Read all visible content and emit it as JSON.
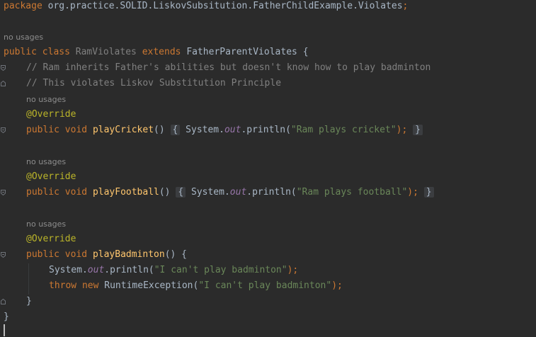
{
  "editor": {
    "package_line": {
      "keyword": "package",
      "name": "org.practice.SOLID.LiskovSubsitution.FatherChildExample.Violates",
      "semicolon": ";"
    },
    "hint_class": "no usages",
    "class_decl": {
      "kw_public": "public",
      "kw_class": "class",
      "name": "RamViolates",
      "kw_extends": "extends",
      "parent": "FatherParentViolates",
      "brace": "{"
    },
    "comment1": "// Ram inherits Father's abilities but doesn't know how to play badminton",
    "comment2": "// This violates Liskov Substitution Principle",
    "methods": [
      {
        "hint": "no usages",
        "annotation": "@Override",
        "kw_public": "public",
        "kw_void": "void",
        "name": "playCricket",
        "parens": "()",
        "open": "{",
        "sys": "System.",
        "out": "out",
        "println": ".println(",
        "string": "\"Ram plays cricket\"",
        "close_call": ");",
        "close": "}"
      },
      {
        "hint": "no usages",
        "annotation": "@Override",
        "kw_public": "public",
        "kw_void": "void",
        "name": "playFootball",
        "parens": "()",
        "open": "{",
        "sys": "System.",
        "out": "out",
        "println": ".println(",
        "string": "\"Ram plays football\"",
        "close_call": ");",
        "close": "}"
      },
      {
        "hint": "no usages",
        "annotation": "@Override",
        "kw_public": "public",
        "kw_void": "void",
        "name": "playBadminton",
        "parens": "()",
        "open": "{",
        "sys": "System.",
        "out": "out",
        "println": ".println(",
        "string": "\"I can't play badminton\"",
        "close_call": ");",
        "throw_kw": "throw",
        "new_kw": "new",
        "exception": "RuntimeException(",
        "exception_string": "\"I can't play badminton\"",
        "exception_close": ");",
        "close": "}"
      }
    ],
    "class_close": "}"
  },
  "colors": {
    "background": "#2b2b2b",
    "keyword": "#cc7832",
    "text": "#a9b7c6",
    "comment": "#808080",
    "annotation": "#bbb529",
    "method": "#ffc66d",
    "field": "#9876aa",
    "string": "#6a8759",
    "hint": "#8c8c8c"
  },
  "icons": [
    "fold-icon",
    "text-caret"
  ]
}
